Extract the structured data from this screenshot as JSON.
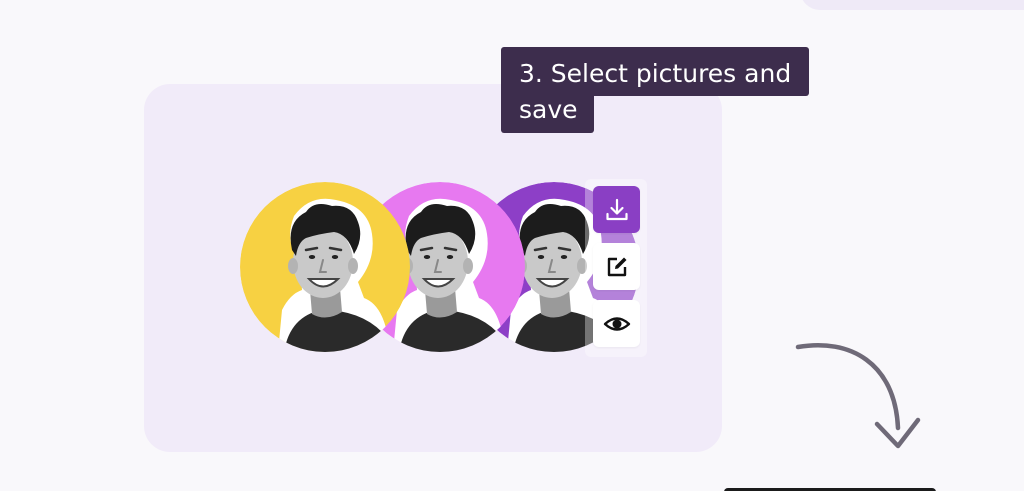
{
  "step_label": {
    "text": "3. Select pictures and save"
  },
  "avatars": [
    {
      "background": "#f7d142"
    },
    {
      "background": "#e779f0"
    },
    {
      "background": "#8d3fc7"
    }
  ],
  "actions": [
    {
      "icon": "download-icon",
      "active": true
    },
    {
      "icon": "edit-icon",
      "active": false
    },
    {
      "icon": "eye-icon",
      "active": false
    }
  ],
  "colors": {
    "card_bg": "#f1ebf9",
    "label_bg": "#3d2d4d",
    "accent": "#8a3fc4",
    "arrow": "#6f6a78"
  }
}
